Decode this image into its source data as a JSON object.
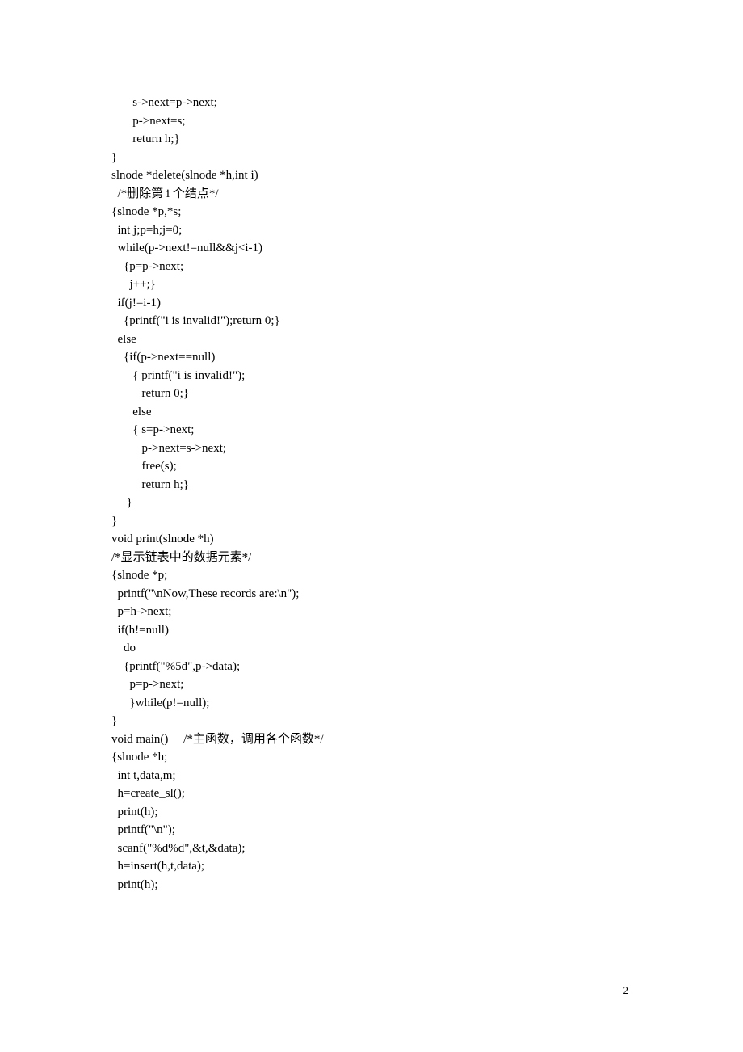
{
  "code": {
    "lines": [
      "       s->next=p->next;",
      "       p->next=s;",
      "       return h;}",
      "}",
      "slnode *delete(slnode *h,int i)",
      "  /*删除第 i 个结点*/",
      "{slnode *p,*s;",
      "  int j;p=h;j=0;",
      "  while(p->next!=null&&j<i-1)",
      "    {p=p->next;",
      "      j++;}",
      "  if(j!=i-1)",
      "    {printf(\"i is invalid!\");return 0;}",
      "  else",
      "    {if(p->next==null)",
      "       { printf(\"i is invalid!\");",
      "          return 0;}",
      "       else",
      "       { s=p->next;",
      "          p->next=s->next;",
      "          free(s);",
      "          return h;}",
      "     }",
      "}",
      "void print(slnode *h)",
      "/*显示链表中的数据元素*/",
      "{slnode *p;",
      "  printf(\"\\nNow,These records are:\\n\");",
      "  p=h->next;",
      "  if(h!=null)",
      "    do",
      "    {printf(\"%5d\",p->data);",
      "      p=p->next;",
      "      }while(p!=null);",
      "}",
      "void main()     /*主函数，调用各个函数*/",
      "{slnode *h;",
      "  int t,data,m;",
      "  h=create_sl();",
      "  print(h);",
      "  printf(\"\\n\");",
      "  scanf(\"%d%d\",&t,&data);",
      "  h=insert(h,t,data);",
      "  print(h);"
    ]
  },
  "footer": {
    "page_number": "2"
  }
}
